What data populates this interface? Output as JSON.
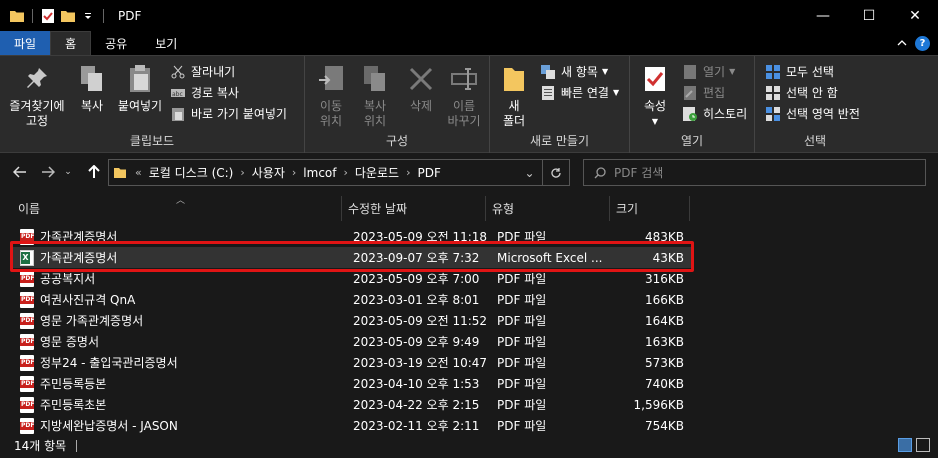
{
  "window": {
    "title": "PDF",
    "minimize": "—",
    "maximize": "☐",
    "close": "✕"
  },
  "tabs": {
    "file": "파일",
    "home": "홈",
    "share": "공유",
    "view": "보기"
  },
  "ribbon": {
    "clipboard": {
      "label": "클립보드",
      "pin_line1": "즐겨찾기에",
      "pin_line2": "고정",
      "copy": "복사",
      "paste": "붙여넣기",
      "cut": "잘라내기",
      "copy_path": "경로 복사",
      "paste_shortcut": "바로 가기 붙여넣기"
    },
    "organize": {
      "label": "구성",
      "move_line1": "이동",
      "move_line2": "위치",
      "copy_line1": "복사",
      "copy_line2": "위치",
      "delete": "삭제",
      "rename_line1": "이름",
      "rename_line2": "바꾸기"
    },
    "new": {
      "label": "새로 만들기",
      "folder_line1": "새",
      "folder_line2": "폴더",
      "new_item": "새 항목",
      "easy_access": "빠른 연결"
    },
    "open": {
      "label": "열기",
      "properties": "속성",
      "open": "열기",
      "edit": "편집",
      "history": "히스토리"
    },
    "select": {
      "label": "선택",
      "select_all": "모두 선택",
      "select_none": "선택 안 함",
      "invert": "선택 영역 반전"
    }
  },
  "address": {
    "overflow": "«",
    "crumbs": [
      "로컬 디스크 (C:)",
      "사용자",
      "lmcof",
      "다운로드",
      "PDF"
    ],
    "search_placeholder": "PDF 검색"
  },
  "columns": {
    "name": "이름",
    "modified": "수정한 날짜",
    "type": "유형",
    "size": "크기"
  },
  "files": [
    {
      "name": "가족관계증명서",
      "date": "2023-05-09 오전 11:18",
      "type": "PDF 파일",
      "size": "483KB",
      "icon": "pdf"
    },
    {
      "name": "가족관계증명서",
      "date": "2023-09-07 오후 7:32",
      "type": "Microsoft Excel ...",
      "size": "43KB",
      "icon": "excel"
    },
    {
      "name": "공공복지서",
      "date": "2023-05-09 오후 7:00",
      "type": "PDF 파일",
      "size": "316KB",
      "icon": "pdf"
    },
    {
      "name": "여권사진규격 QnA",
      "date": "2023-03-01 오후 8:01",
      "type": "PDF 파일",
      "size": "166KB",
      "icon": "pdf"
    },
    {
      "name": "영문 가족관계증명서",
      "date": "2023-05-09 오전 11:52",
      "type": "PDF 파일",
      "size": "164KB",
      "icon": "pdf"
    },
    {
      "name": "영문 증명서",
      "date": "2023-05-09 오후 9:49",
      "type": "PDF 파일",
      "size": "163KB",
      "icon": "pdf"
    },
    {
      "name": "정부24 - 출입국관리증명서",
      "date": "2023-03-19 오전 10:47",
      "type": "PDF 파일",
      "size": "573KB",
      "icon": "pdf"
    },
    {
      "name": "주민등록등본",
      "date": "2023-04-10 오후 1:53",
      "type": "PDF 파일",
      "size": "740KB",
      "icon": "pdf"
    },
    {
      "name": "주민등록초본",
      "date": "2023-04-22 오후 2:15",
      "type": "PDF 파일",
      "size": "1,596KB",
      "icon": "pdf"
    },
    {
      "name": "지방세완납증명서 - JASON",
      "date": "2023-02-11 오후 2:11",
      "type": "PDF 파일",
      "size": "754KB",
      "icon": "pdf"
    }
  ],
  "status": {
    "count": "14개 항목"
  },
  "colors": {
    "file_tab": "#1f5fb0",
    "highlight": "#e01414",
    "background": "#191919"
  }
}
